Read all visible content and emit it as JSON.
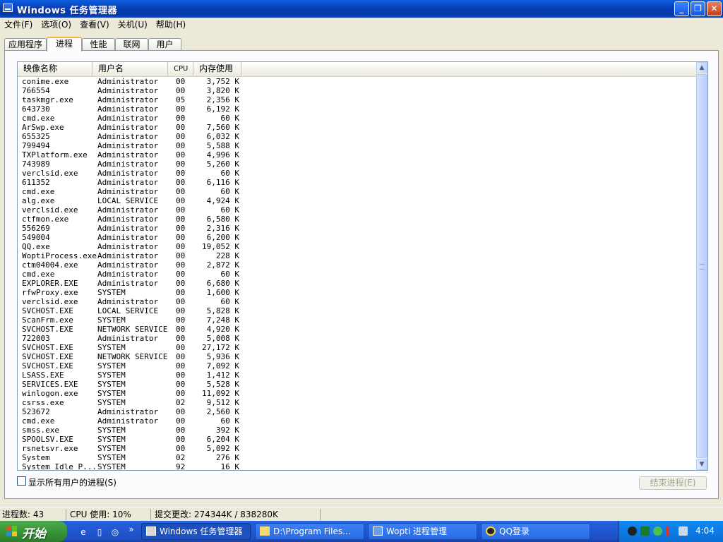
{
  "window": {
    "title": "Windows 任务管理器",
    "minimize": "_",
    "maximize": "❐",
    "close": "✕"
  },
  "menu": [
    "文件(F)",
    "选项(O)",
    "查看(V)",
    "关机(U)",
    "帮助(H)"
  ],
  "tabs": [
    "应用程序",
    "进程",
    "性能",
    "联网",
    "用户"
  ],
  "active_tab": "进程",
  "columns": [
    "映像名称",
    "用户名",
    "CPU",
    "内存使用"
  ],
  "processes": [
    [
      "conime.exe",
      "Administrator",
      "00",
      "3,752 K"
    ],
    [
      "766554",
      "Administrator",
      "00",
      "3,820 K"
    ],
    [
      "taskmgr.exe",
      "Administrator",
      "05",
      "2,356 K"
    ],
    [
      "643730",
      "Administrator",
      "00",
      "6,192 K"
    ],
    [
      "cmd.exe",
      "Administrator",
      "00",
      "60 K"
    ],
    [
      "ArSwp.exe",
      "Administrator",
      "00",
      "7,560 K"
    ],
    [
      "655325",
      "Administrator",
      "00",
      "6,032 K"
    ],
    [
      "799494",
      "Administrator",
      "00",
      "5,588 K"
    ],
    [
      "TXPlatform.exe",
      "Administrator",
      "00",
      "4,996 K"
    ],
    [
      "743989",
      "Administrator",
      "00",
      "5,260 K"
    ],
    [
      "verclsid.exe",
      "Administrator",
      "00",
      "60 K"
    ],
    [
      "611352",
      "Administrator",
      "00",
      "6,116 K"
    ],
    [
      "cmd.exe",
      "Administrator",
      "00",
      "60 K"
    ],
    [
      "alg.exe",
      "LOCAL SERVICE",
      "00",
      "4,924 K"
    ],
    [
      "verclsid.exe",
      "Administrator",
      "00",
      "60 K"
    ],
    [
      "ctfmon.exe",
      "Administrator",
      "00",
      "6,580 K"
    ],
    [
      "556269",
      "Administrator",
      "00",
      "2,316 K"
    ],
    [
      "549004",
      "Administrator",
      "00",
      "6,200 K"
    ],
    [
      "QQ.exe",
      "Administrator",
      "00",
      "19,052 K"
    ],
    [
      "WoptiProcess.exe",
      "Administrator",
      "00",
      "228 K"
    ],
    [
      "ctm04004.exe",
      "Administrator",
      "00",
      "2,872 K"
    ],
    [
      "cmd.exe",
      "Administrator",
      "00",
      "60 K"
    ],
    [
      "EXPLORER.EXE",
      "Administrator",
      "00",
      "6,680 K"
    ],
    [
      "rfwProxy.exe",
      "SYSTEM",
      "00",
      "1,600 K"
    ],
    [
      "verclsid.exe",
      "Administrator",
      "00",
      "60 K"
    ],
    [
      "SVCHOST.EXE",
      "LOCAL SERVICE",
      "00",
      "5,828 K"
    ],
    [
      "ScanFrm.exe",
      "SYSTEM",
      "00",
      "7,248 K"
    ],
    [
      "SVCHOST.EXE",
      "NETWORK SERVICE",
      "00",
      "4,920 K"
    ],
    [
      "722003",
      "Administrator",
      "00",
      "5,008 K"
    ],
    [
      "SVCHOST.EXE",
      "SYSTEM",
      "00",
      "27,172 K"
    ],
    [
      "SVCHOST.EXE",
      "NETWORK SERVICE",
      "00",
      "5,936 K"
    ],
    [
      "SVCHOST.EXE",
      "SYSTEM",
      "00",
      "7,092 K"
    ],
    [
      "LSASS.EXE",
      "SYSTEM",
      "00",
      "1,412 K"
    ],
    [
      "SERVICES.EXE",
      "SYSTEM",
      "00",
      "5,528 K"
    ],
    [
      "winlogon.exe",
      "SYSTEM",
      "00",
      "11,092 K"
    ],
    [
      "csrss.exe",
      "SYSTEM",
      "02",
      "9,512 K"
    ],
    [
      "523672",
      "Administrator",
      "00",
      "2,560 K"
    ],
    [
      "cmd.exe",
      "Administrator",
      "00",
      "60 K"
    ],
    [
      "smss.exe",
      "SYSTEM",
      "00",
      "392 K"
    ],
    [
      "SPOOLSV.EXE",
      "SYSTEM",
      "00",
      "6,204 K"
    ],
    [
      "rsnetsvr.exe",
      "SYSTEM",
      "00",
      "5,092 K"
    ],
    [
      "System",
      "SYSTEM",
      "02",
      "276 K"
    ],
    [
      "System Idle P...",
      "SYSTEM",
      "92",
      "16 K"
    ]
  ],
  "show_all_users": {
    "label": "显示所有用户的进程(S)",
    "checked": false
  },
  "end_process": "结束进程(E)",
  "scroll": {
    "up": "▲",
    "down": "▼"
  },
  "status": {
    "processes": "进程数: 43",
    "cpu": "CPU 使用: 10%",
    "commit": "提交更改: 274344K / 838280K"
  },
  "taskbar": {
    "start": "开始",
    "quicklaunch_more": "»",
    "tasks": [
      "Windows 任务管理器",
      "D:\\Program Files...",
      "Wopti 进程管理",
      "QQ登录"
    ],
    "active_task": "Windows 任务管理器",
    "clock": "4:04"
  },
  "colors": {
    "titlebar": "#0a46c0",
    "window_bg": "#ece9d8",
    "taskbar": "#245edb",
    "start_button": "#3a963a",
    "tray": "#0d7be3"
  }
}
